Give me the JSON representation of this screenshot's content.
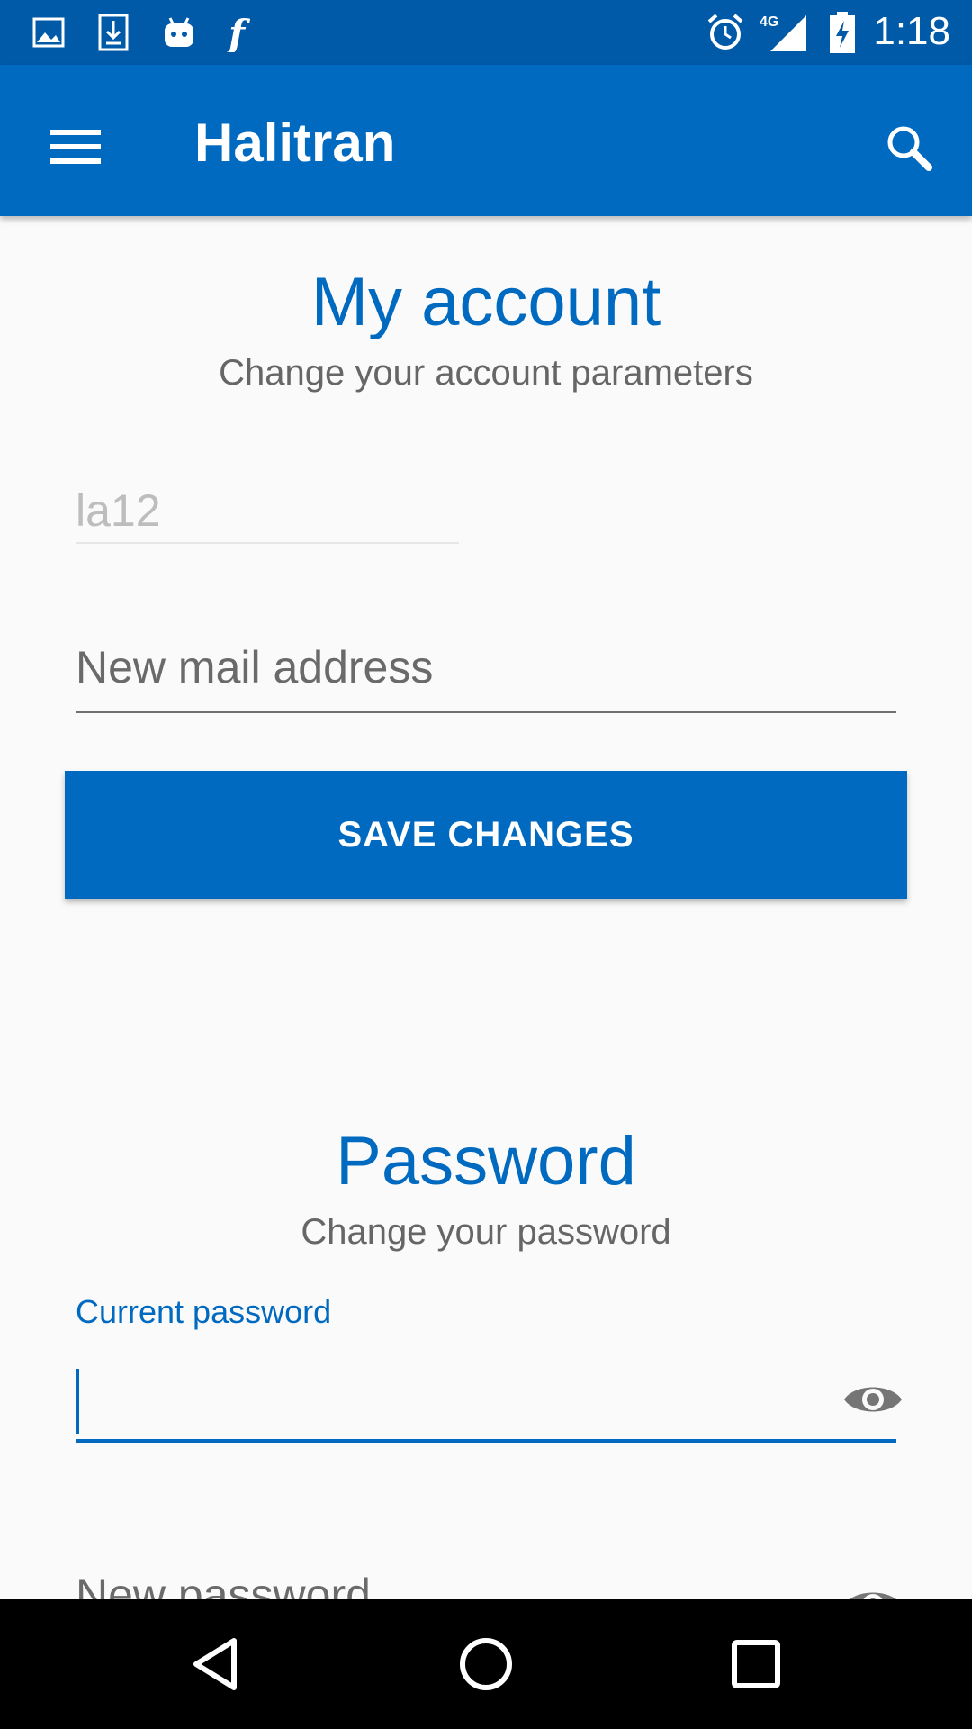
{
  "status_bar": {
    "time": "1:18",
    "network": "4G",
    "left_icons": [
      "gallery-icon",
      "download-icon",
      "android-icon",
      "flipboard-icon"
    ],
    "right_icons": [
      "alarm-icon",
      "signal-icon",
      "battery-charging-icon"
    ]
  },
  "app_bar": {
    "title": "Halitran",
    "menu_icon": "menu-icon",
    "search_icon": "search-icon"
  },
  "account": {
    "title": "My account",
    "subtitle": "Change your account parameters",
    "username_value": "la12",
    "email_placeholder": "New mail address",
    "save_label": "SAVE CHANGES"
  },
  "password": {
    "title": "Password",
    "subtitle": "Change your password",
    "current_label": "Current password",
    "current_value": "",
    "new_placeholder": "New password"
  },
  "colors": {
    "primary": "#0069c0",
    "status_bar": "#005aa8",
    "background": "#fafafa"
  }
}
